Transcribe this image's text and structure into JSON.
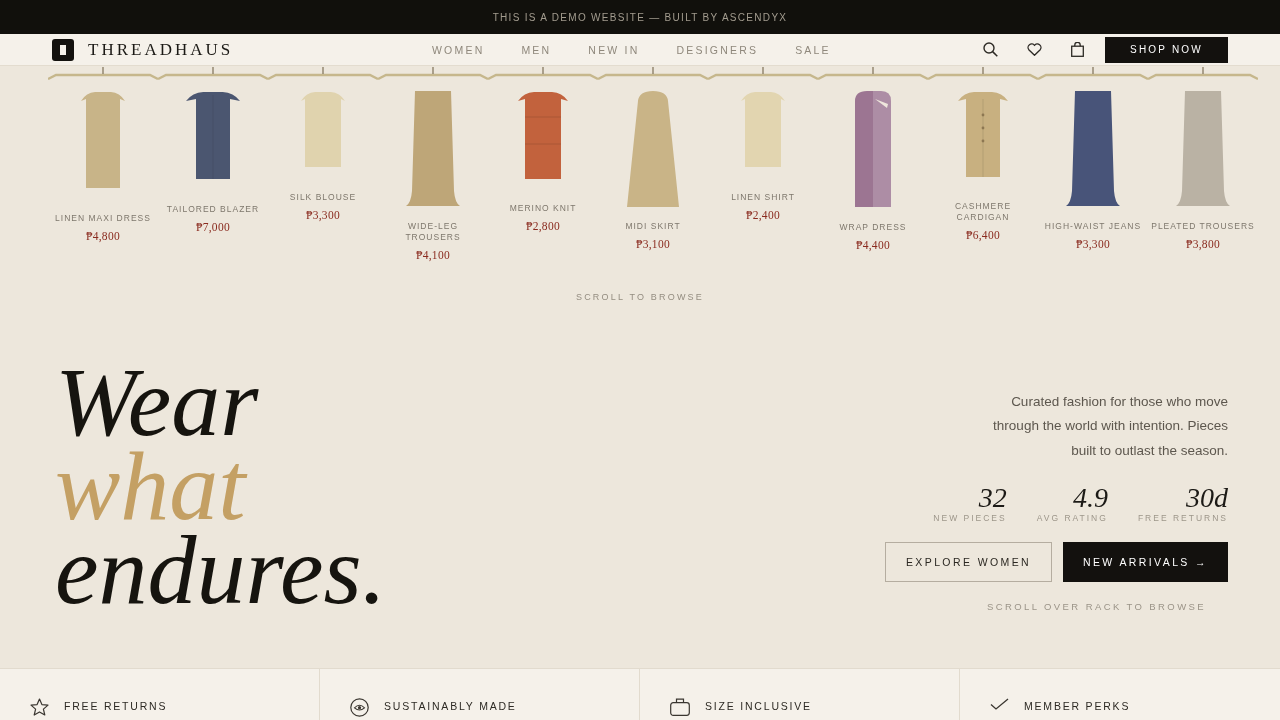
{
  "announcement": {
    "text": "THIS IS A DEMO WEBSITE — BUILT BY ASCENDYX"
  },
  "header": {
    "logo": "THREADHAUS",
    "nav": [
      "WOMEN",
      "MEN",
      "NEW IN",
      "DESIGNERS",
      "SALE"
    ],
    "cta": "SHOP NOW"
  },
  "rack": {
    "items": [
      {
        "kind": "dress",
        "name": "LINEN MAXI DRESS",
        "price": "₱4,800",
        "color": "#c8b488"
      },
      {
        "kind": "jacket",
        "name": "TAILORED BLAZER",
        "price": "₱7,000",
        "color": "#4b5670"
      },
      {
        "kind": "top",
        "name": "SILK BLOUSE",
        "price": "₱3,300",
        "color": "#e0d3ae"
      },
      {
        "kind": "trousers",
        "name": "WIDE-LEG TROUSERS",
        "price": "₱4,100",
        "color": "#bea678"
      },
      {
        "kind": "sweater",
        "name": "MERINO KNIT",
        "price": "₱2,800",
        "color": "#c2623d"
      },
      {
        "kind": "skirt",
        "name": "MIDI SKIRT",
        "price": "₱3,100",
        "color": "#c9b487"
      },
      {
        "kind": "top",
        "name": "LINEN SHIRT",
        "price": "₱2,400",
        "color": "#e2d5b0"
      },
      {
        "kind": "wrap",
        "name": "WRAP DRESS",
        "price": "₱4,400",
        "color": "#9c7592"
      },
      {
        "kind": "cardigan",
        "name": "CASHMERE CARDIGAN",
        "price": "₱6,400",
        "color": "#c8b080"
      },
      {
        "kind": "trousers",
        "name": "HIGH-WAIST JEANS",
        "price": "₱3,300",
        "color": "#485479"
      },
      {
        "kind": "trousers",
        "name": "PLEATED TROUSERS",
        "price": "₱3,800",
        "color": "#bab2a4"
      }
    ],
    "hint": "SCROLL TO BROWSE"
  },
  "hero": {
    "headline": [
      {
        "text": "Wear",
        "accent": false
      },
      {
        "text": "what",
        "accent": true
      },
      {
        "text": "endures.",
        "accent": false
      }
    ],
    "intro": "Curated fashion for those who move through the world with intention. Pieces built to outlast the season.",
    "stats": [
      {
        "value": "32",
        "label": "NEW PIECES"
      },
      {
        "value": "4.9",
        "label": "AVG RATING"
      },
      {
        "value": "30d",
        "label": "FREE RETURNS"
      }
    ],
    "buttons": [
      {
        "kind": "outline",
        "label": "EXPLORE WOMEN"
      },
      {
        "kind": "solid",
        "label": "NEW ARRIVALS →"
      }
    ],
    "hint": "SCROLL OVER RACK TO BROWSE"
  },
  "features": [
    {
      "kind": "returns",
      "title": "FREE RETURNS"
    },
    {
      "kind": "sustainable",
      "title": "SUSTAINABLY MADE"
    },
    {
      "kind": "sizing",
      "title": "SIZE INCLUSIVE"
    },
    {
      "kind": "perks",
      "title": "MEMBER PERKS"
    }
  ]
}
